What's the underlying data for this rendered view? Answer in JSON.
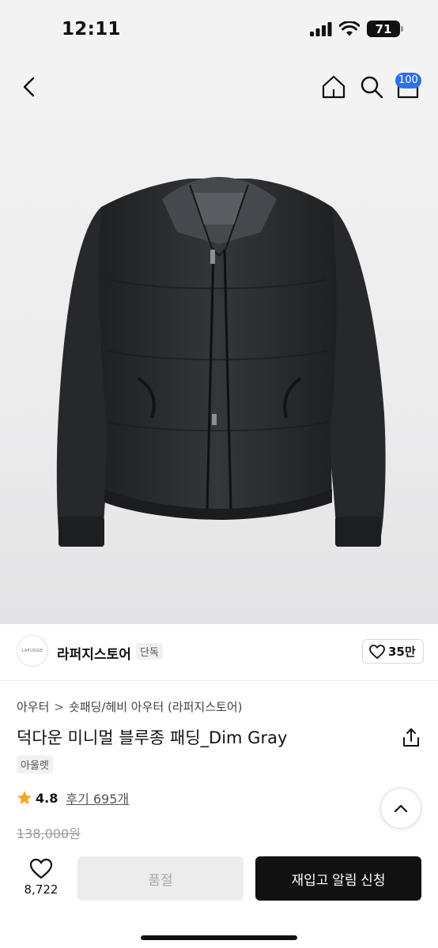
{
  "status_bar": {
    "time": "12:11",
    "battery": "71",
    "icons": [
      "signal-icon",
      "wifi-icon",
      "battery-icon"
    ]
  },
  "nav": {
    "icons": [
      "back-icon",
      "home-icon",
      "search-icon",
      "cart-icon"
    ],
    "cart_badge": "100",
    "badge_color": "#2f6fe8"
  },
  "product_image": {
    "subject_icon": "jacket-image",
    "jacket_color": "#2c2d2f"
  },
  "brand": {
    "logo_text": "LAFUDGE",
    "name": "라퍼지스토어",
    "tag": "단독",
    "like_count": "35만"
  },
  "product": {
    "breadcrumb": [
      "아우터",
      "숏패딩/헤비 아우터 (라퍼지스토어)"
    ],
    "breadcrumb_separator": ">",
    "title": "덕다운 미니멀 블루종 패딩_Dim Gray",
    "outlet_tag": "아울렛",
    "rating": "4.8",
    "reviews": "후기 695개",
    "original_price": "138,000원",
    "star_color": "#f5a623"
  },
  "bottom_bar": {
    "wish_count": "8,722",
    "soldout_label": "품절",
    "restock_label": "재입고 알림 신청"
  }
}
